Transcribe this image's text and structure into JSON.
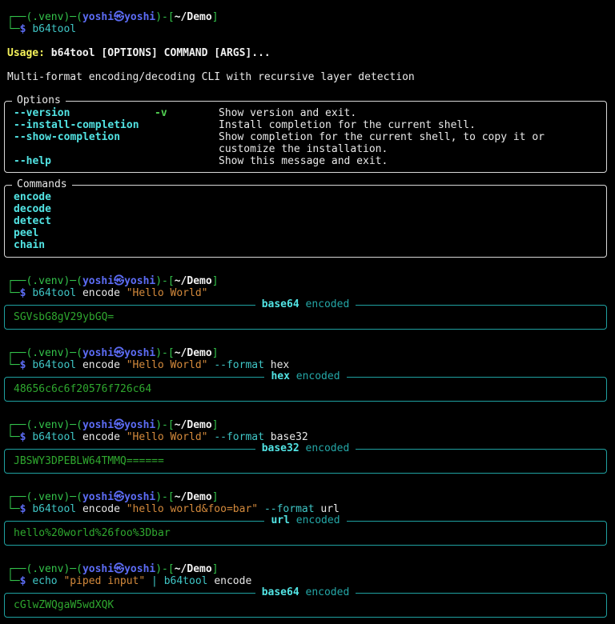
{
  "prompt": {
    "venv": "(.venv)",
    "user": "yoshi",
    "at": "㉿",
    "host": "yoshi",
    "dir": "~/Demo",
    "dollar": "$"
  },
  "first_command": "b64tool",
  "usage": {
    "label": "Usage:",
    "text": "b64tool [OPTIONS] COMMAND [ARGS]..."
  },
  "description": "Multi-format encoding/decoding CLI with recursive layer detection",
  "options_panel": {
    "title": "Options",
    "options": [
      {
        "flag": "--version",
        "short": "-v",
        "desc": "Show version and exit."
      },
      {
        "flag": "--install-completion",
        "short": "",
        "desc": "Install completion for the current shell."
      },
      {
        "flag": "--show-completion",
        "short": "",
        "desc": "Show completion for the current shell, to copy it or",
        "desc2": "customize the installation."
      },
      {
        "flag": "--help",
        "short": "",
        "desc": "Show this message and exit."
      }
    ]
  },
  "commands_panel": {
    "title": "Commands",
    "commands": [
      "encode",
      "decode",
      "detect",
      "peel",
      "chain"
    ]
  },
  "runs": [
    {
      "prog": "b64tool",
      "sub": "encode",
      "arg": "\"Hello World\"",
      "flag": "",
      "flagval": "",
      "format": "base64",
      "encoded_word": "encoded",
      "result": "SGVsbG8gV29ybGQ="
    },
    {
      "prog": "b64tool",
      "sub": "encode",
      "arg": "\"Hello World\"",
      "flag": "--format",
      "flagval": "hex",
      "format": "hex",
      "encoded_word": "encoded",
      "result": "48656c6c6f20576f726c64"
    },
    {
      "prog": "b64tool",
      "sub": "encode",
      "arg": "\"Hello World\"",
      "flag": "--format",
      "flagval": "base32",
      "format": "base32",
      "encoded_word": "encoded",
      "result": "JBSWY3DPEBLW64TMMQ======"
    },
    {
      "prog": "b64tool",
      "sub": "encode",
      "arg": "\"hello world&foo=bar\"",
      "flag": "--format",
      "flagval": "url",
      "format": "url",
      "encoded_word": "encoded",
      "result": "hello%20world%26foo%3Dbar"
    }
  ],
  "piped_run": {
    "echo": "echo",
    "arg": "\"piped input\"",
    "pipe": "|",
    "prog": "b64tool",
    "sub": "encode",
    "format": "base64",
    "encoded_word": "encoded",
    "result": "cGlwZWQgaW5wdXQK"
  }
}
